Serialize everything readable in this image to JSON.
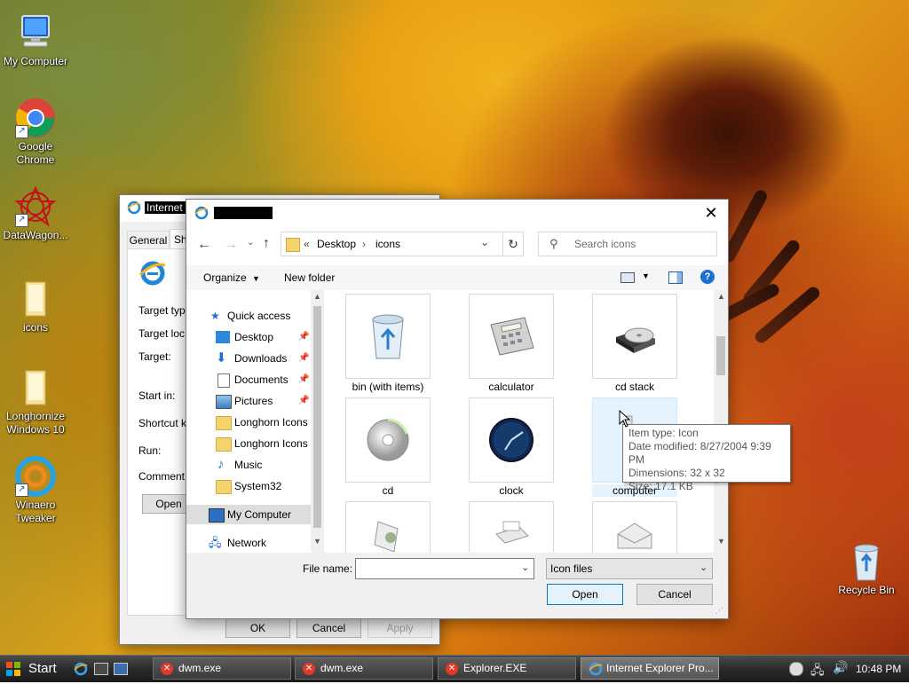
{
  "desktop": {
    "icons": [
      {
        "label": "My Computer"
      },
      {
        "label": "Google Chrome"
      },
      {
        "label": "DataWagon..."
      },
      {
        "label": "icons"
      },
      {
        "label": "Longhornize Windows 10"
      },
      {
        "label": "Winaero Tweaker"
      },
      {
        "label": "Recycle Bin"
      }
    ]
  },
  "properties_window": {
    "title": "Internet Explorer Properties",
    "tabs": [
      "General",
      "Sh"
    ],
    "fields": {
      "target_type": "Target typ",
      "target_location": "Target loc",
      "target": "Target:",
      "start_in": "Start in:",
      "shortcut_key": "Shortcut k",
      "run": "Run:",
      "comment": "Comment:"
    },
    "open_button": "Open",
    "ok": "OK",
    "cancel": "Cancel",
    "apply": "Apply"
  },
  "dialog": {
    "title": "",
    "breadcrumb": {
      "prefix": "«",
      "items": [
        "Desktop",
        "icons"
      ]
    },
    "search_placeholder": "Search icons",
    "toolbar": {
      "organize": "Organize",
      "new_folder": "New folder",
      "help": "?"
    },
    "nav": {
      "quick_access": "Quick access",
      "items": [
        {
          "label": "Desktop",
          "pinned": true
        },
        {
          "label": "Downloads",
          "pinned": true
        },
        {
          "label": "Documents",
          "pinned": true
        },
        {
          "label": "Pictures",
          "pinned": true
        },
        {
          "label": "Longhorn Icons",
          "pinned": false
        },
        {
          "label": "Longhorn Icons",
          "pinned": false
        },
        {
          "label": "Music",
          "pinned": false
        },
        {
          "label": "System32",
          "pinned": false
        }
      ],
      "my_computer": "My Computer",
      "network": "Network"
    },
    "files": [
      {
        "label": "bin (with items)",
        "icon": "recycle-bin-icon"
      },
      {
        "label": "calculator",
        "icon": "calculator-icon"
      },
      {
        "label": "cd stack",
        "icon": "cd-stack-icon"
      },
      {
        "label": "cd",
        "icon": "cd-icon"
      },
      {
        "label": "clock",
        "icon": "clock-icon"
      },
      {
        "label": "computer",
        "icon": "computer-icon"
      }
    ],
    "tooltip": {
      "type": "Item type: Icon",
      "modified": "Date modified: 8/27/2004 9:39 PM",
      "dimensions": "Dimensions: 32 x 32",
      "size": "Size: 17.1 KB"
    },
    "file_name_label": "File name:",
    "file_name_value": "",
    "file_type": "Icon files",
    "open": "Open",
    "cancel": "Cancel"
  },
  "taskbar": {
    "start": "Start",
    "tasks": [
      {
        "label": "dwm.exe"
      },
      {
        "label": "dwm.exe"
      },
      {
        "label": "Explorer.EXE"
      },
      {
        "label": "Internet Explorer Pro..."
      }
    ],
    "clock": "10:48 PM"
  }
}
